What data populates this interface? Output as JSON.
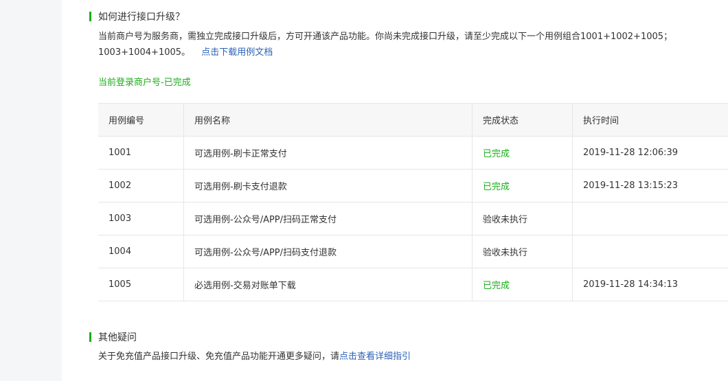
{
  "section1": {
    "heading": "如何进行接口升级？",
    "desc": "当前商户号为服务商，需独立完成接口升级后，方可开通该产品功能。你尚未完成接口升级，请至少完成以下一个用例组合1001+1002+1005；1003+1004+1005。",
    "download_link": "点击下载用例文档",
    "login_status": "当前登录商户号-已完成"
  },
  "table": {
    "headers": [
      "用例编号",
      "用例名称",
      "完成状态",
      "执行时间"
    ],
    "rows": [
      {
        "id": "1001",
        "name": "可选用例-刷卡正常支付",
        "status": "已完成",
        "time": "2019-11-28 12:06:39"
      },
      {
        "id": "1002",
        "name": "可选用例-刷卡支付退款",
        "status": "已完成",
        "time": "2019-11-28 13:15:23"
      },
      {
        "id": "1003",
        "name": "可选用例-公众号/APP/扫码正常支付",
        "status": "验收未执行",
        "time": ""
      },
      {
        "id": "1004",
        "name": "可选用例-公众号/APP/扫码支付退款",
        "status": "验收未执行",
        "time": ""
      },
      {
        "id": "1005",
        "name": "必选用例-交易对账单下载",
        "status": "已完成",
        "time": "2019-11-28 14:34:13"
      }
    ]
  },
  "section2": {
    "heading": "其他疑问",
    "desc": "关于免充值产品接口升级、免充值产品功能开通更多疑问，请",
    "link": "点击查看详细指引"
  },
  "colors": {
    "accent_green": "#1aad19",
    "link_blue": "#2c61b8"
  }
}
